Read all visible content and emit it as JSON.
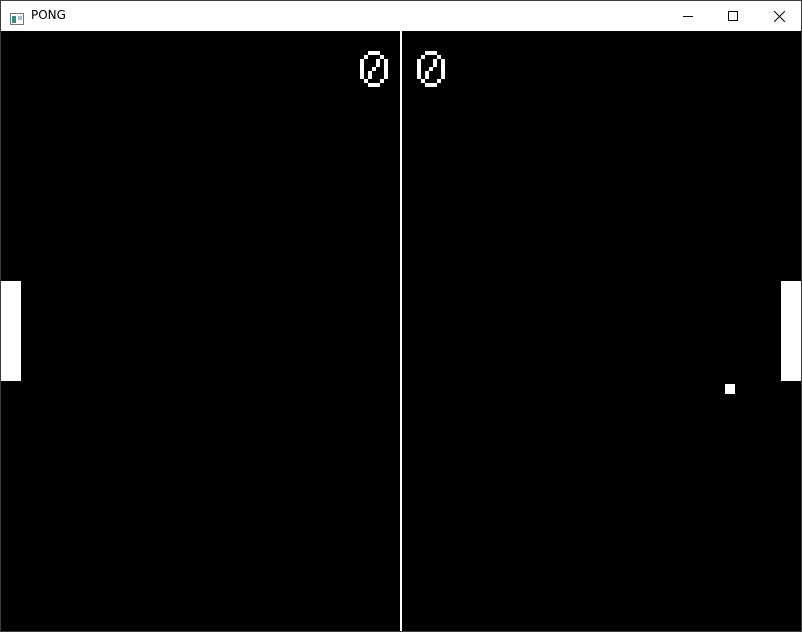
{
  "window": {
    "title": "PONG",
    "icons": {
      "app": "pong-app-icon",
      "minimize": "minimize-icon",
      "maximize": "maximize-icon",
      "close": "close-icon"
    }
  },
  "game": {
    "colors": {
      "background": "#000000",
      "foreground": "#ffffff"
    },
    "score_left": "0",
    "score_right": "0"
  }
}
